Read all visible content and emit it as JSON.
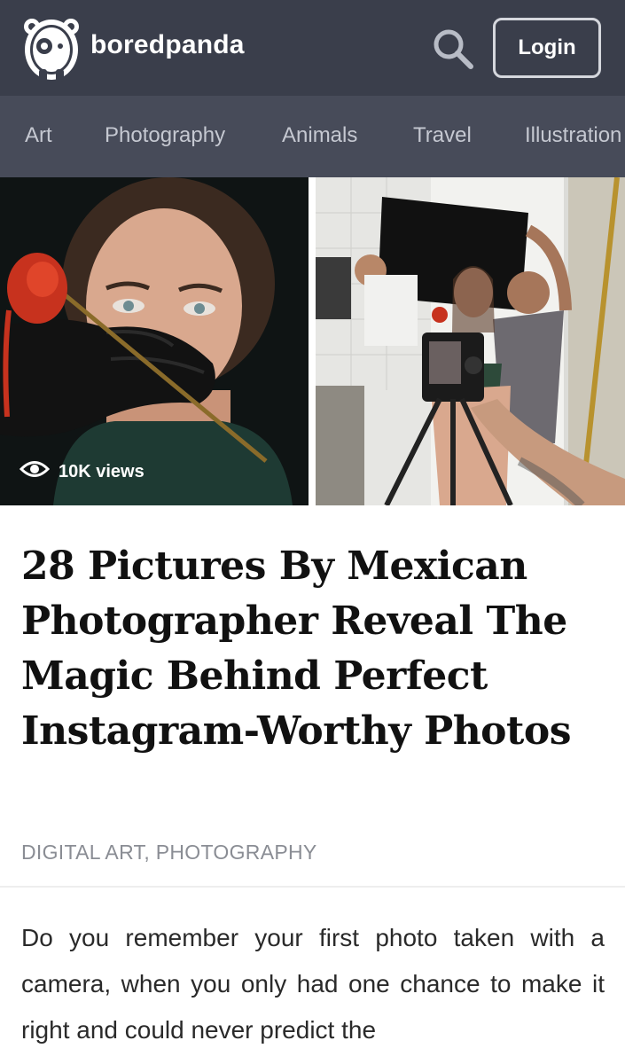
{
  "header": {
    "brand": "boredpanda",
    "login_label": "Login",
    "logo_icon": "panda-icon",
    "search_icon": "search-icon",
    "background": "#3a3e4b"
  },
  "nav": {
    "background": "#474b59",
    "items": [
      {
        "label": "Art"
      },
      {
        "label": "Photography"
      },
      {
        "label": "Animals"
      },
      {
        "label": "Travel"
      },
      {
        "label": "Illustration"
      }
    ]
  },
  "article": {
    "views": "10K views",
    "views_icon": "eye-icon",
    "title": "28 Pictures By Mexican Photographer Reveal The Magic Behind Perfect Instagram-Worthy Photos",
    "category": "DIGITAL ART, PHOTOGRAPHY",
    "intro": "Do you remember your first photo taken with a camera, when you only had one chance to make it right and could never predict the"
  }
}
